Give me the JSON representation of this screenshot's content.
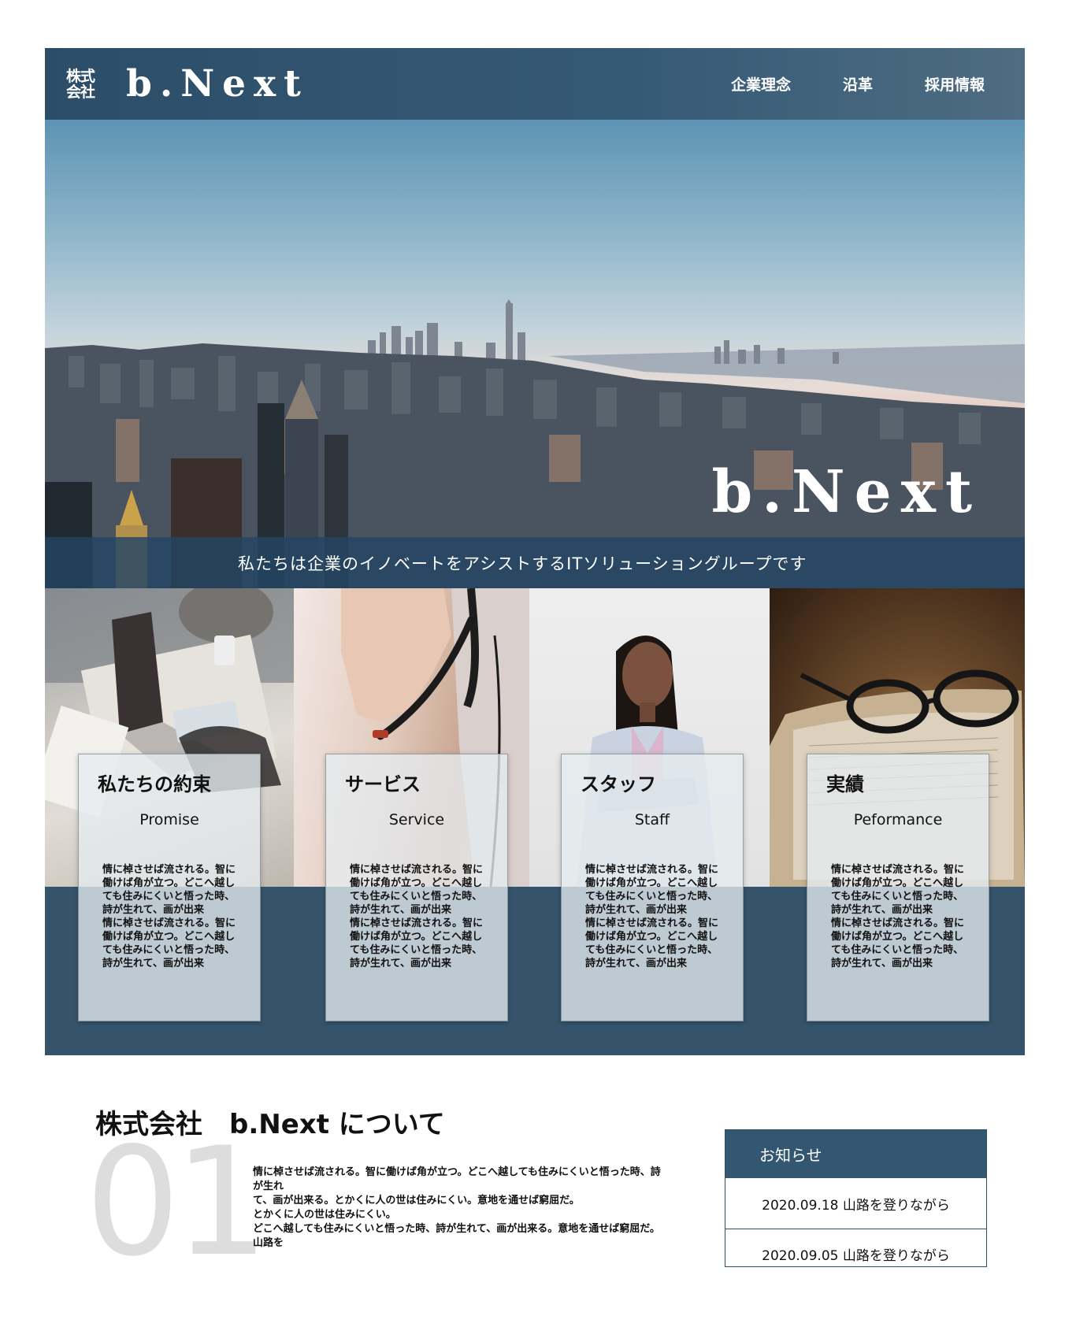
{
  "header": {
    "logo_kabushiki_line1": "株式",
    "logo_kabushiki_line2": "会社",
    "logo_text": "b.Next",
    "nav": [
      {
        "label": "企業理念"
      },
      {
        "label": "沿革"
      },
      {
        "label": "採用情報"
      }
    ]
  },
  "hero": {
    "title": "b.Next",
    "tagline": "私たちは企業のイノベートをアシストするITソリューショングループです"
  },
  "features": [
    {
      "title": "私たちの約束",
      "subtitle": "Promise",
      "body": "情に棹させば流される。智に\n働けば角が立つ。どこへ越し\nても住みにくいと悟った時、\n詩が生れて、画が出来\n情に棹させば流される。智に\n働けば角が立つ。どこへ越し\nても住みにくいと悟った時、\n詩が生れて、画が出来"
    },
    {
      "title": "サービス",
      "subtitle": "Service",
      "body": "情に棹させば流される。智に\n働けば角が立つ。どこへ越し\nても住みにくいと悟った時、\n詩が生れて、画が出来\n情に棹させば流される。智に\n働けば角が立つ。どこへ越し\nても住みにくいと悟った時、\n詩が生れて、画が出来"
    },
    {
      "title": "スタッフ",
      "subtitle": "Staff",
      "body": "情に棹させば流される。智に\n働けば角が立つ。どこへ越し\nても住みにくいと悟った時、\n詩が生れて、画が出来\n情に棹させば流される。智に\n働けば角が立つ。どこへ越し\nても住みにくいと悟った時、\n詩が生れて、画が出来"
    },
    {
      "title": "実績",
      "subtitle": "Peformance",
      "body": "情に棹させば流される。智に\n働けば角が立つ。どこへ越し\nても住みにくいと悟った時、\n詩が生れて、画が出来\n情に棹させば流される。智に\n働けば角が立つ。どこへ越し\nても住みにくいと悟った時、\n詩が生れて、画が出来"
    }
  ],
  "about": {
    "title": "株式会社　b.Next について",
    "number": "01",
    "body": "情に棹させば流される。智に働けば角が立つ。どこへ越しても住みにくいと悟った時、詩が生れ\nて、画が出来る。とかくに人の世は住みにくい。意地を通せば窮屈だ。\nとかくに人の世は住みにくい。\nどこへ越しても住みにくいと悟った時、詩が生れて、画が出来る。意地を通せば窮屈だ。山路を"
  },
  "news": {
    "heading": "お知らせ",
    "items": [
      {
        "text": "2020.09.18 山路を登りながら"
      },
      {
        "text": "2020.09.05 山路を登りながら"
      }
    ]
  },
  "colors": {
    "brand_navy": "#335770",
    "header_navy": "#2c4d68",
    "about_number_gray": "#dddddd"
  }
}
